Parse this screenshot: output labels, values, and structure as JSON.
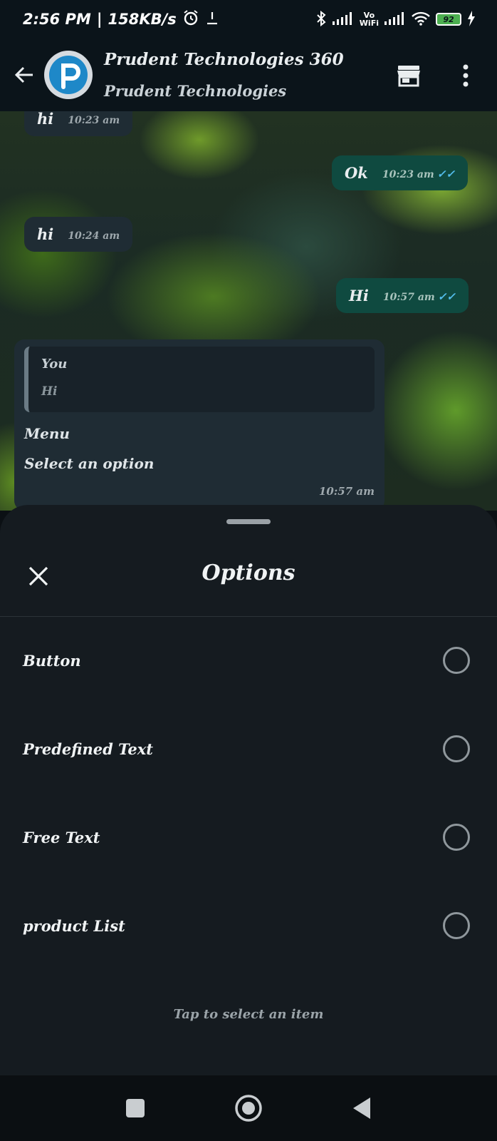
{
  "status": {
    "time": "2:56 PM",
    "speed": "158KB/s",
    "battery": "92",
    "icons": [
      "alarm-icon",
      "download-icon",
      "bluetooth-icon",
      "signal-icon",
      "vowifi-icon",
      "wifi-icon",
      "charging-icon"
    ],
    "vowifi_label": "Vo\nWiFi"
  },
  "header": {
    "title": "Prudent Technologies 360",
    "subtitle": "Prudent Technologies"
  },
  "chat": {
    "messages": [
      {
        "dir": "in",
        "text": "hi",
        "time": "10:23 am"
      },
      {
        "dir": "out",
        "text": "Ok",
        "time": "10:23 am"
      },
      {
        "dir": "in",
        "text": "hi",
        "time": "10:24 am"
      },
      {
        "dir": "out",
        "text": "Hi",
        "time": "10:57 am"
      }
    ],
    "card": {
      "quote_author": "You",
      "quote_text": "Hi",
      "line1": "Menu",
      "line2": "Select an option",
      "time": "10:57 am"
    }
  },
  "sheet": {
    "title": "Options",
    "options": [
      "Button",
      "Predefined Text",
      "Free Text",
      "product List"
    ],
    "hint": "Tap to select an item"
  },
  "colors": {
    "incoming_bubble": "#1f2c34",
    "outgoing_bubble": "#0f4a40",
    "read_ticks": "#53bdeb",
    "sheet_bg": "#151b20"
  }
}
